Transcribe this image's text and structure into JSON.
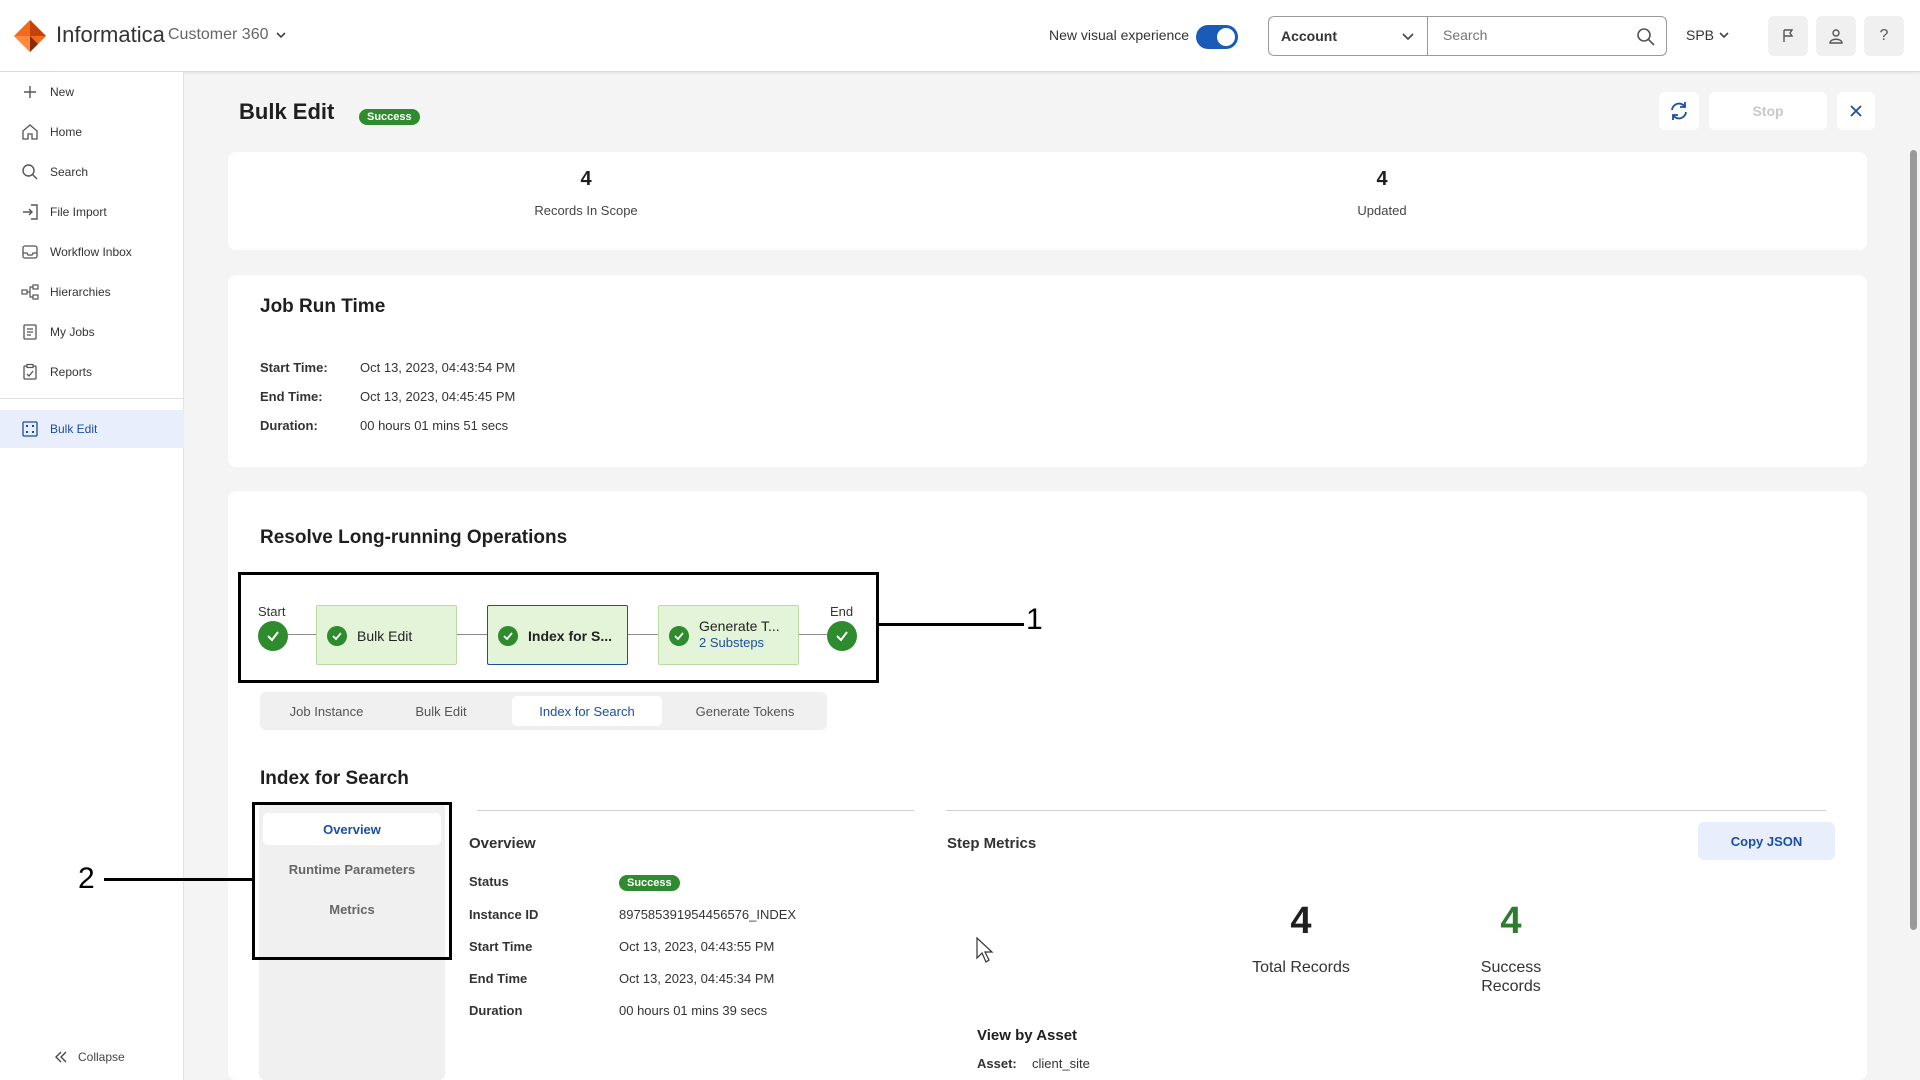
{
  "header": {
    "brand": "Informatica",
    "product": "Customer 360",
    "new_visual_label": "New visual experience",
    "account_select": "Account",
    "search_placeholder": "Search",
    "org": "SPB",
    "help": "?"
  },
  "sidebar": {
    "items": [
      {
        "label": "New",
        "icon": "plus-icon"
      },
      {
        "label": "Home",
        "icon": "home-icon"
      },
      {
        "label": "Search",
        "icon": "search-icon"
      },
      {
        "label": "File Import",
        "icon": "import-icon"
      },
      {
        "label": "Workflow Inbox",
        "icon": "inbox-icon"
      },
      {
        "label": "Hierarchies",
        "icon": "hierarchy-icon"
      },
      {
        "label": "My Jobs",
        "icon": "jobs-icon"
      },
      {
        "label": "Reports",
        "icon": "reports-icon"
      }
    ],
    "active_item": {
      "label": "Bulk Edit",
      "icon": "grid-icon"
    },
    "collapse_label": "Collapse"
  },
  "page": {
    "title": "Bulk Edit",
    "status": "Success",
    "stop_label": "Stop"
  },
  "summary": {
    "records_in_scope": "4",
    "records_in_scope_label": "Records In Scope",
    "updated": "4",
    "updated_label": "Updated"
  },
  "job_run": {
    "title": "Job Run Time",
    "rows": [
      {
        "key": "Start Time:",
        "value": "Oct 13, 2023, 04:43:54 PM"
      },
      {
        "key": "End Time:",
        "value": "Oct 13, 2023, 04:45:45 PM"
      },
      {
        "key": "Duration:",
        "value": "00 hours 01 mins 51 secs"
      }
    ]
  },
  "operations": {
    "title": "Resolve Long-running Operations",
    "start_label": "Start",
    "end_label": "End",
    "steps": [
      {
        "label": "Bulk Edit",
        "sub": ""
      },
      {
        "label": "Index for S...",
        "sub": ""
      },
      {
        "label": "Generate T...",
        "sub": "2 Substeps"
      }
    ],
    "callout_1": "1",
    "callout_2": "2",
    "tabs": [
      "Job Instance",
      "Bulk Edit",
      "Index for Search",
      "Generate Tokens"
    ],
    "active_tab": "Index for Search"
  },
  "detail": {
    "title": "Index for Search",
    "subnav": [
      "Overview",
      "Runtime Parameters",
      "Metrics"
    ],
    "overview_title": "Overview",
    "status_key": "Status",
    "status_value": "Success",
    "rows": [
      {
        "key": "Instance ID",
        "value": "897585391954456576_INDEX"
      },
      {
        "key": "Start Time",
        "value": "Oct 13, 2023, 04:43:55 PM"
      },
      {
        "key": "End Time",
        "value": "Oct 13, 2023, 04:45:34 PM"
      },
      {
        "key": "Duration",
        "value": "00 hours 01 mins 39 secs"
      }
    ],
    "step_metrics_title": "Step Metrics",
    "copy_json_label": "Copy JSON",
    "total_records": "4",
    "total_records_label": "Total Records",
    "success_records": "4",
    "success_records_label_1": "Success",
    "success_records_label_2": "Records",
    "view_by_asset_title": "View by Asset",
    "asset_key": "Asset:",
    "asset_value": "client_site"
  },
  "colors": {
    "accent": "#1a4fa3",
    "success": "#2e8b2e",
    "step_fill": "#e3f4d8",
    "brand_orange": "#f26b1d"
  }
}
